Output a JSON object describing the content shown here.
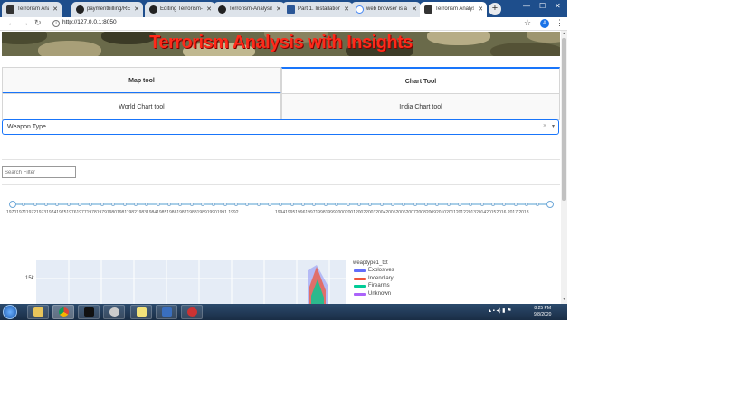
{
  "browser": {
    "tabs": [
      {
        "title": "Terrorism Analysis",
        "icon": "plotly-icon"
      },
      {
        "title": "paymentbilling/RE",
        "icon": "github-icon"
      },
      {
        "title": "Editing Terrorism-",
        "icon": "github-icon"
      },
      {
        "title": "Terrorism-Analysis",
        "icon": "github-icon"
      },
      {
        "title": "Part 1. Installation",
        "icon": "document-icon"
      },
      {
        "title": "web browser is a w",
        "icon": "google-icon"
      },
      {
        "title": "Terrorism Analysis",
        "icon": "plotly-icon",
        "active": true
      }
    ],
    "new_tab": "+",
    "url": "http://127.0.0.1:8050",
    "avatar_letter": "A"
  },
  "page": {
    "title": "Terrorism Analysis with Insights",
    "main_tabs": [
      {
        "label": "Map tool",
        "selected": false
      },
      {
        "label": "Chart Tool",
        "selected": true
      }
    ],
    "sub_tabs": [
      {
        "label": "World Chart tool",
        "selected": true
      },
      {
        "label": "India Chart tool",
        "selected": false
      }
    ],
    "dropdown": {
      "value": "Weapon Type",
      "clear": "×",
      "arrow": "▾"
    },
    "search": {
      "placeholder": "Search Filter"
    },
    "slider": {
      "labels_left": "1970197119721973197419751976197719781979198019811982198319841985198619871988198919901991 1992",
      "labels_right": "19941995199619971998199920002001200220032004200520062007200820092010201120122013201420152016 2017 2018"
    }
  },
  "chart_data": {
    "type": "area",
    "ytick_visible": "15k",
    "legend_title": "weaptype1_txt",
    "series": [
      {
        "name": "Explosives",
        "color": "#636efa"
      },
      {
        "name": "Incendiary",
        "color": "#ef553b"
      },
      {
        "name": "Firearms",
        "color": "#00cc96"
      },
      {
        "name": "Unknown",
        "color": "#ab63fa"
      }
    ]
  },
  "taskbar": {
    "clock_time": "8:25 PM",
    "clock_date": "9/8/2020"
  }
}
